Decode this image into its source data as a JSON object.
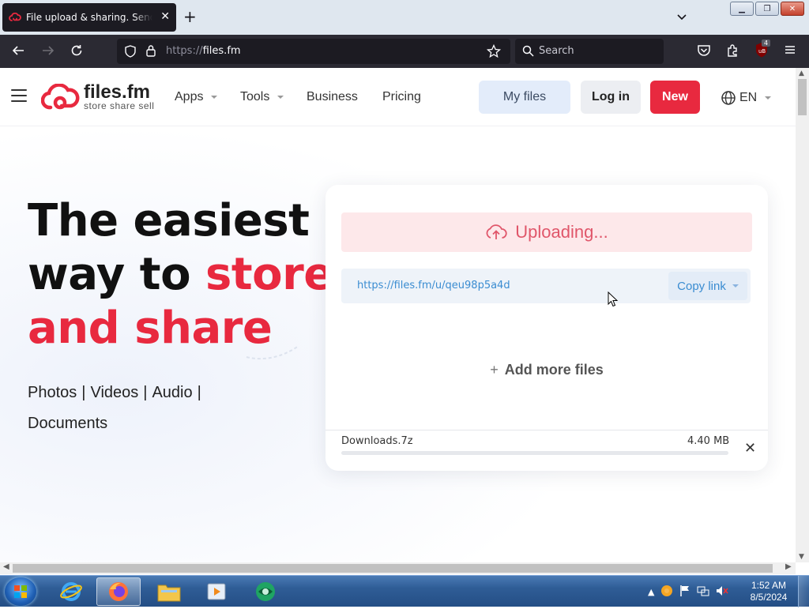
{
  "browser": {
    "tab_title": "File upload & sharing. Send large files",
    "url_prefix": "https://",
    "url_host": "files.fm",
    "search_placeholder": "Search",
    "extension_badge": "4"
  },
  "header": {
    "logo_name": "files.fm",
    "logo_tagline": "store  share  sell",
    "menu": [
      {
        "label": "Apps"
      },
      {
        "label": "Tools"
      },
      {
        "label": "Business"
      },
      {
        "label": "Pricing"
      }
    ],
    "my_files": "My files",
    "log_in": "Log in",
    "new": "New",
    "language": "EN"
  },
  "hero": {
    "line1": "The easiest",
    "line2a": "way to ",
    "line2b": "store",
    "line3": "and share",
    "types": [
      "Photos",
      "Videos",
      "Audio",
      "Documents"
    ],
    "separator": "|"
  },
  "upload": {
    "status": "Uploading...",
    "share_link": "https://files.fm/u/qeu98p5a4d",
    "copy_link": "Copy link",
    "add_more": "Add more files",
    "file_name": "Downloads.7z",
    "file_size": "4.40 MB",
    "progress": 0.0
  },
  "taskbar": {
    "time": "1:52 AM",
    "date": "8/5/2024"
  },
  "colors": {
    "brand_red": "#e8293f",
    "link_blue": "#3a8cd1"
  }
}
